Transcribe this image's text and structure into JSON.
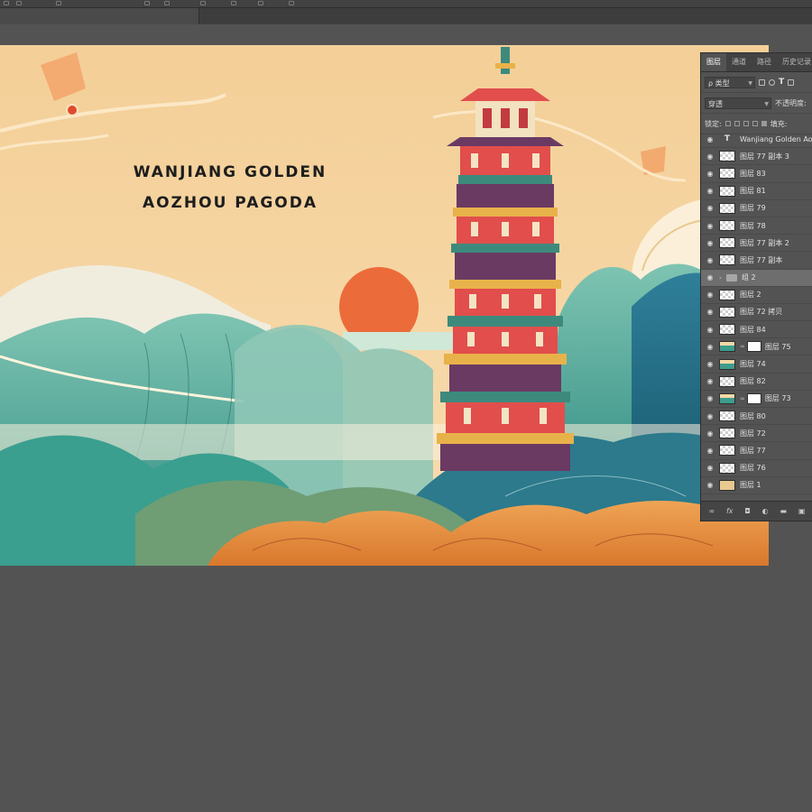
{
  "canvas": {
    "title_line1": "WANJIANG GOLDEN",
    "title_line2": "AOZHOU PAGODA"
  },
  "layers_panel": {
    "tabs": [
      "图层",
      "通道",
      "路径",
      "历史记录"
    ],
    "filter_kind": "ρ 类型",
    "blend_mode": "穿透",
    "opacity_label": "不透明度:",
    "lock_label": "锁定:",
    "fill_label": "填充:",
    "layers": [
      {
        "name": "Wanjiang Golden Aozhou Pagoda",
        "kind": "text"
      },
      {
        "name": "图层 77 副本 3",
        "kind": "pixel"
      },
      {
        "name": "图层 83",
        "kind": "pixel"
      },
      {
        "name": "图层 81",
        "kind": "pixel"
      },
      {
        "name": "图层 79",
        "kind": "pixel"
      },
      {
        "name": "图层 78",
        "kind": "pixel"
      },
      {
        "name": "图层 77 副本 2",
        "kind": "pixel"
      },
      {
        "name": "图层 77 副本",
        "kind": "pixel"
      },
      {
        "name": "组 2",
        "kind": "group"
      },
      {
        "name": "图层 2",
        "kind": "pixel"
      },
      {
        "name": "图层 72 拷贝",
        "kind": "pixel"
      },
      {
        "name": "图层 84",
        "kind": "pixel"
      },
      {
        "name": "图层 75",
        "kind": "masked"
      },
      {
        "name": "图层 74",
        "kind": "pixel"
      },
      {
        "name": "图层 82",
        "kind": "pixel"
      },
      {
        "name": "图层 73",
        "kind": "masked"
      },
      {
        "name": "图层 80",
        "kind": "pixel"
      },
      {
        "name": "图层 72",
        "kind": "pixel"
      },
      {
        "name": "图层 77",
        "kind": "pixel"
      },
      {
        "name": "图层 76",
        "kind": "pixel"
      },
      {
        "name": "图层 1",
        "kind": "fill"
      }
    ],
    "footer_icons": [
      "link-icon",
      "fx-icon",
      "mask-icon",
      "adjustment-icon",
      "folder-icon",
      "new-layer-icon"
    ]
  },
  "colors": {
    "workspace": "#535353",
    "canvas_bg": "#f5cf97",
    "teal": "#2f9487",
    "orange": "#e08a3c",
    "sun": "#ec6b3a",
    "pagoda_red": "#e14e4c"
  }
}
